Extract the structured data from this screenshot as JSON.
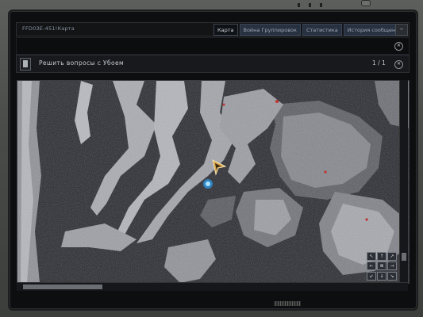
{
  "window": {
    "title": "FFD0ЗЕ-451!Карта",
    "minimize_label": "–"
  },
  "tabs": [
    {
      "label": "Карта",
      "active": true
    },
    {
      "label": "Война Группировок",
      "active": false
    },
    {
      "label": "Статистика",
      "active": false
    },
    {
      "label": "История сообщений",
      "active": false
    }
  ],
  "task": {
    "text": "Решить вопросы с Убоем",
    "counter": "1 / 1"
  },
  "map_controls": {
    "buttons": [
      "↖",
      "↑",
      "↗",
      "←",
      "⊕",
      "→",
      "↙",
      "↓",
      "↘"
    ]
  },
  "icons": {
    "player_marker": "player-arrow-icon",
    "objective_marker": "blue-objective-icon"
  },
  "colors": {
    "tab_inactive": "#27313f",
    "tab_active": "#0f1216",
    "map_base": "#2b2c33",
    "map_light": "#a7a9b0"
  }
}
